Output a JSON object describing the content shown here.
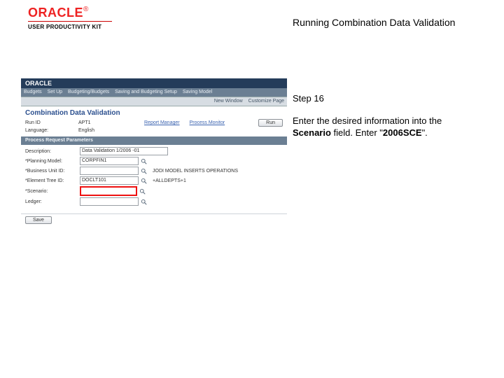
{
  "header": {
    "logo_text": "ORACLE",
    "subbrand": "USER PRODUCTIVITY KIT",
    "doc_title": "Running Combination Data Validation"
  },
  "instruction": {
    "step_label": "Step 16",
    "line1": "Enter the desired information into the ",
    "field_name": "Scenario",
    "line2": " field. Enter \"",
    "value": "2006SCE",
    "line3": "\"."
  },
  "app": {
    "brand": "ORACLE",
    "tabs": [
      "Budgets",
      "Set Up",
      "Budgeting/Budgets",
      "Saving and Budgeting Setup",
      "Saving Model"
    ],
    "subbar_left": "",
    "subbar_right": [
      "New Window",
      "Customize Page"
    ],
    "page_title": "Combination Data Validation",
    "run": {
      "lbl_runid": "Run ID",
      "val_runid": "APT1",
      "link_manager": "Report Manager",
      "link_monitor": "Process Monitor",
      "btn_run": "Run",
      "lbl_lang": "Language:",
      "val_lang": "English"
    },
    "panel_header": "Process Request Parameters",
    "form": {
      "lbl_desc": "Description:",
      "val_desc": "Data Validation 1/2006 -01",
      "lbl_model": "*Planning Model:",
      "val_model": "CORPFIN1",
      "lbl_bus": "*Business Unit ID:",
      "val_bus": "",
      "bus_desc": "JODI MODEL INSERTS OPERATIONS",
      "lbl_tree": "*Element Tree ID:",
      "val_tree": "DOCLT101",
      "tree_desc": "+ALLDEPTS+1",
      "lbl_scen": "*Scenario:",
      "lbl_ledger": "Ledger:"
    },
    "footer_btn": "Save"
  }
}
